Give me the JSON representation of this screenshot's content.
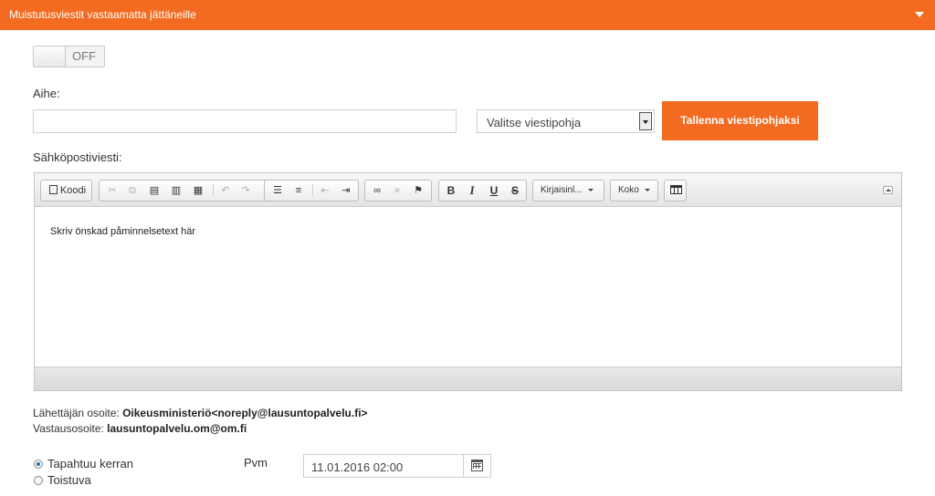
{
  "panel": {
    "title": "Muistutusviestit vastaamatta jättäneille"
  },
  "toggle": {
    "label": "OFF"
  },
  "subject": {
    "label": "Aihe:",
    "value": ""
  },
  "template_select": {
    "selected": "Valitse viestipohja"
  },
  "save_template_button": {
    "label": "Tallenna viestipohjaksi"
  },
  "email": {
    "label": "Sähköpostiviesti:"
  },
  "toolbar": {
    "source_label": "Koodi",
    "font_combo": "Kirjaisinl...",
    "size_combo": "Koko",
    "bold": "B",
    "italic": "I",
    "underline": "U",
    "strike": "S"
  },
  "editor": {
    "content": "Skriv önskad påminnelsetext här"
  },
  "sender": {
    "sender_label": "Lähettäjän osoite:",
    "sender_value": "Oikeusministeriö<noreply@lausuntopalvelu.fi>",
    "reply_label": "Vastausosoite:",
    "reply_value": "lausuntopalvelu.om@om.fi"
  },
  "schedule": {
    "option_once": "Tapahtuu kerran",
    "option_recurring": "Toistuva",
    "selected": "Tapahtuu kerran",
    "date_label": "Pvm",
    "date_value": "11.01.2016 02:00"
  },
  "colors": {
    "accent": "#f26b21"
  }
}
